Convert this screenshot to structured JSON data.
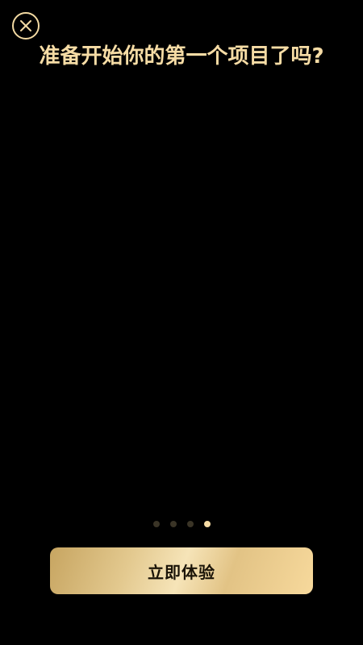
{
  "close": {
    "icon": "close-icon",
    "color": "#f2d9a2"
  },
  "title": "准备开始你的第一个项目了吗?",
  "pagination": {
    "total": 4,
    "active_index": 3,
    "active_color": "#f6dca5",
    "inactive_color": "#3a3426"
  },
  "cta": {
    "label": "立即体验"
  }
}
